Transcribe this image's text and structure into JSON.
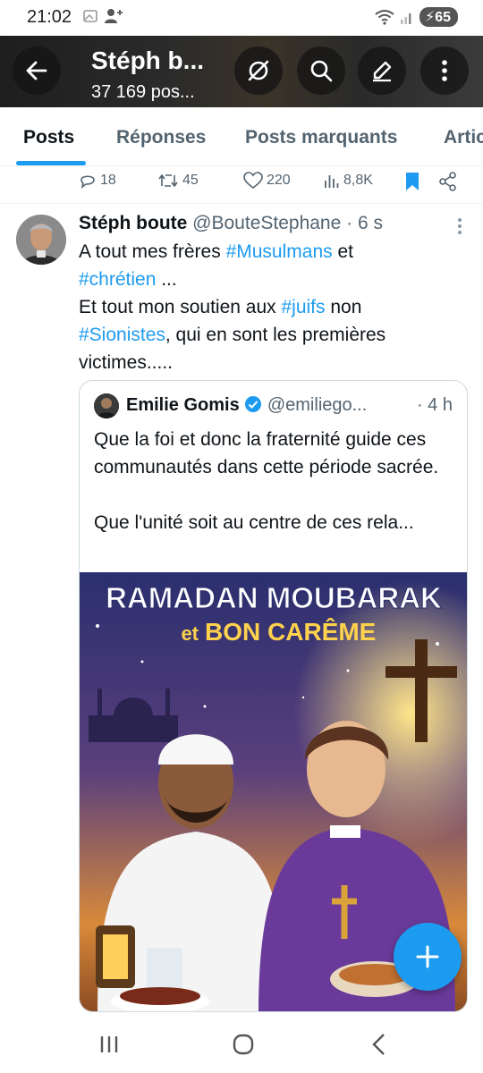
{
  "status_bar": {
    "time": "21:02",
    "battery": "65"
  },
  "header": {
    "title": "Stéph b...",
    "subtitle": "37 169 pos..."
  },
  "tabs": [
    {
      "label": "Posts"
    },
    {
      "label": "Réponses"
    },
    {
      "label": "Posts marquants"
    },
    {
      "label": "Artic"
    }
  ],
  "prev_actions": {
    "replies": "18",
    "reposts": "45",
    "likes": "220",
    "views": "8,8K"
  },
  "post": {
    "author": "Stéph boute",
    "handle": "@BouteStephane",
    "time": "· 6 s",
    "text": {
      "p1": "A tout mes frères ",
      "tag1": "#Musulmans",
      "p2": " et ",
      "tag2": "#chrétien",
      "p3": " ...",
      "p4": "Et tout mon soutien aux ",
      "tag3": "#juifs",
      "p5": " non ",
      "tag4": "#Sionistes",
      "p6": ", qui en sont les premières victimes....."
    }
  },
  "quote": {
    "author": "Emilie Gomis",
    "handle": "@emiliego...",
    "time": "· 4 h",
    "line1": "Que la foi et donc la fraternité guide ces communautés dans cette période sacrée.",
    "line2": "Que l'unité soit au centre de ces rela...",
    "image_title_1": "RAMADAN MOUBARAK",
    "image_title_2_prefix": "et",
    "image_title_2": "BON CARÊME"
  },
  "colors": {
    "accent": "#1d9bf0",
    "text": "#0f1419",
    "muted": "#536471"
  }
}
